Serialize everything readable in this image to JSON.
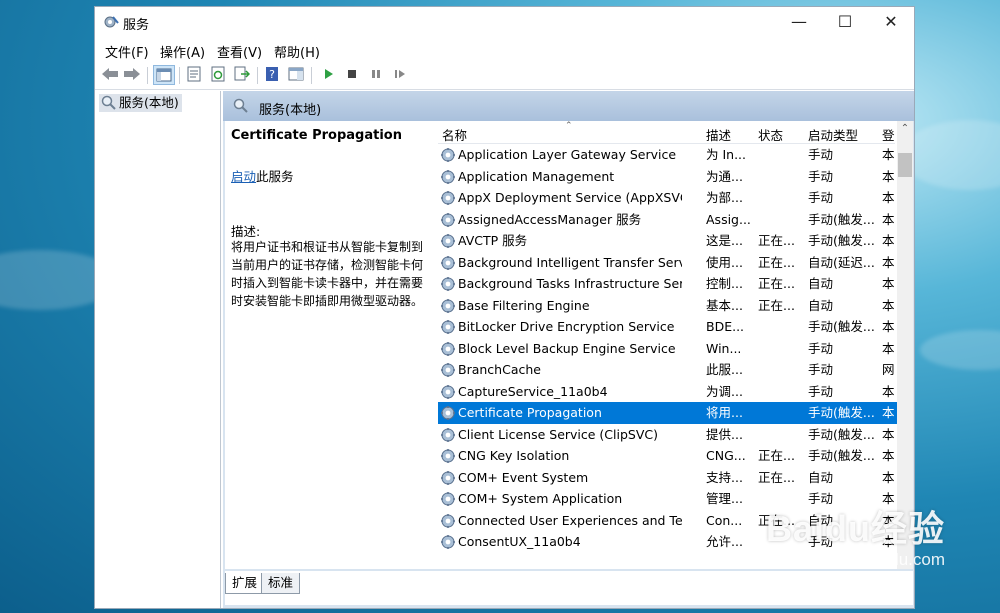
{
  "window": {
    "title": "服务",
    "controls": [
      "—",
      "☐",
      "✕"
    ]
  },
  "menu": [
    "文件(F)",
    "操作(A)",
    "查看(V)",
    "帮助(H)"
  ],
  "tree": {
    "root_label": "服务(本地)"
  },
  "panel": {
    "header_title": "服务(本地)"
  },
  "description": {
    "service_name": "Certificate Propagation",
    "start_link": "启动",
    "start_suffix": "此服务",
    "label": "描述:",
    "text": "将用户证书和根证书从智能卡复制到当前用户的证书存储，检测智能卡何时插入到智能卡读卡器中，并在需要时安装智能卡即插即用微型驱动器。"
  },
  "list": {
    "columns": {
      "name": "名称",
      "desc": "描述",
      "status": "状态",
      "startup": "启动类型",
      "logon": "登"
    },
    "selected_index": 12,
    "rows": [
      {
        "name": "Application Layer Gateway Service",
        "desc": "为 In...",
        "status": "",
        "startup": "手动",
        "logon": "本"
      },
      {
        "name": "Application Management",
        "desc": "为通...",
        "status": "",
        "startup": "手动",
        "logon": "本"
      },
      {
        "name": "AppX Deployment Service (AppXSVC)",
        "desc": "为部...",
        "status": "",
        "startup": "手动",
        "logon": "本"
      },
      {
        "name": "AssignedAccessManager 服务",
        "desc": "Assig...",
        "status": "",
        "startup": "手动(触发...",
        "logon": "本"
      },
      {
        "name": "AVCTP 服务",
        "desc": "这是...",
        "status": "正在...",
        "startup": "手动(触发...",
        "logon": "本"
      },
      {
        "name": "Background Intelligent Transfer Service",
        "desc": "使用...",
        "status": "正在...",
        "startup": "自动(延迟...",
        "logon": "本"
      },
      {
        "name": "Background Tasks Infrastructure Service",
        "desc": "控制...",
        "status": "正在...",
        "startup": "自动",
        "logon": "本"
      },
      {
        "name": "Base Filtering Engine",
        "desc": "基本...",
        "status": "正在...",
        "startup": "自动",
        "logon": "本"
      },
      {
        "name": "BitLocker Drive Encryption Service",
        "desc": "BDE...",
        "status": "",
        "startup": "手动(触发...",
        "logon": "本"
      },
      {
        "name": "Block Level Backup Engine Service",
        "desc": "Win...",
        "status": "",
        "startup": "手动",
        "logon": "本"
      },
      {
        "name": "BranchCache",
        "desc": "此服...",
        "status": "",
        "startup": "手动",
        "logon": "网"
      },
      {
        "name": "CaptureService_11a0b4",
        "desc": "为调...",
        "status": "",
        "startup": "手动",
        "logon": "本"
      },
      {
        "name": "Certificate Propagation",
        "desc": "将用...",
        "status": "",
        "startup": "手动(触发...",
        "logon": "本"
      },
      {
        "name": "Client License Service (ClipSVC)",
        "desc": "提供...",
        "status": "",
        "startup": "手动(触发...",
        "logon": "本"
      },
      {
        "name": "CNG Key Isolation",
        "desc": "CNG...",
        "status": "正在...",
        "startup": "手动(触发...",
        "logon": "本"
      },
      {
        "name": "COM+ Event System",
        "desc": "支持...",
        "status": "正在...",
        "startup": "自动",
        "logon": "本"
      },
      {
        "name": "COM+ System Application",
        "desc": "管理...",
        "status": "",
        "startup": "手动",
        "logon": "本"
      },
      {
        "name": "Connected User Experiences and Teleme...",
        "desc": "Con...",
        "status": "正在...",
        "startup": "自动",
        "logon": "本"
      },
      {
        "name": "ConsentUX_11a0b4",
        "desc": "允许...",
        "status": "",
        "startup": "手动",
        "logon": "本"
      }
    ]
  },
  "tabs": [
    "扩展",
    "标准"
  ],
  "watermark": {
    "line1": "Baidu经验",
    "line2": "jingyan.baidu.com"
  },
  "colors": {
    "selection": "#0078d7",
    "header_band": "#b4c8e0",
    "link": "#1a5fb4"
  }
}
